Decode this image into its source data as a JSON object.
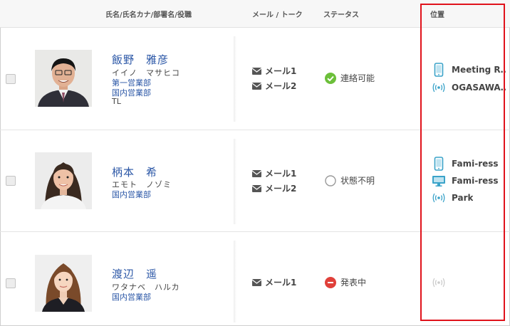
{
  "header": {
    "col_name": "氏名/氏名カナ/部署名/役職",
    "col_mail": "メール / トーク",
    "col_status": "ステータス",
    "col_location": "位置"
  },
  "rows": [
    {
      "name": "飯野　雅彦",
      "kana": "イイノ　マサヒコ",
      "departments": [
        "第一営業部",
        "国内営業部"
      ],
      "role": "TL",
      "mails": [
        "メール1",
        "メール2"
      ],
      "status": {
        "label": "連絡可能",
        "icon": "check-circle-icon",
        "color": "#6cbf3a"
      },
      "locations": [
        {
          "icon": "smartphone-icon",
          "label": "Meeting R…"
        },
        {
          "icon": "beacon-icon",
          "label": "OGASAWA…"
        }
      ]
    },
    {
      "name": "柄本　希",
      "kana": "エモト　ノゾミ",
      "departments": [
        "国内営業部"
      ],
      "role": "",
      "mails": [
        "メール1",
        "メール2"
      ],
      "status": {
        "label": "状態不明",
        "icon": "empty-circle-icon",
        "color": "#999999"
      },
      "locations": [
        {
          "icon": "smartphone-icon",
          "label": "Fami-ress"
        },
        {
          "icon": "monitor-icon",
          "label": "Fami-ress"
        },
        {
          "icon": "beacon-icon",
          "label": "Park"
        }
      ]
    },
    {
      "name": "渡辺　遥",
      "kana": "ワタナベ　ハルカ",
      "departments": [
        "国内営業部"
      ],
      "role": "",
      "mails": [
        "メール1"
      ],
      "status": {
        "label": "発表中",
        "icon": "minus-circle-icon",
        "color": "#e0403a"
      },
      "locations": [
        {
          "icon": "beacon-inactive-icon",
          "label": ""
        }
      ]
    }
  ],
  "colors": {
    "accent_blue": "#2a56a6",
    "location_icon": "#3aa3c9",
    "highlight": "#e0121b"
  }
}
